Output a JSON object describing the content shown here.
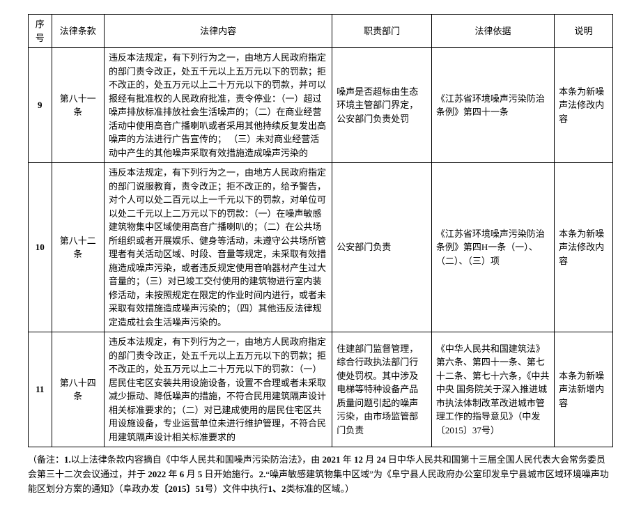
{
  "headers": {
    "idx": "序号",
    "article": "法律条款",
    "content": "法律内容",
    "dept": "职责部门",
    "basis": "法律依据",
    "note": "说明"
  },
  "rows": [
    {
      "idx": "9",
      "article": "第八十一条",
      "content": "违反本法规定，有下列行为之一，由地方人民政府指定的部门责令改正，处五千元以上五万元以下的罚款；拒不改正的，处五万元以上二十万元以下的罚款，并可以报经有批准权的人民政府批准，责令停业：（一）超过噪声排放标准排放社会生活噪声的；（二）在商业经营活动中使用高音广播喇叭或者采用其他持续反复发出高噪声的方法进行广告宣传的；\n（三）未对商业经营活动中产生的其他噪声采取有效措施造成噪声污染的",
      "dept": "噪声是否超标由生态环境主管部门界定，公安部门负责处罚",
      "basis": "《江苏省环境噪声污染防治条例》第四十一条",
      "note": "本条为新噪声法修改内容"
    },
    {
      "idx": "10",
      "article": "第八十二条",
      "content": "违反本法规定，有下列行为之一，由地方人民政府指定的部门说服教育，责令改正；拒不改正的，给予警告，对个人可以处二百元以上一千元以下的罚款，对单位可以处二千元以上二万元以下的罚款：（一）在噪声敏感建筑物集中区域使用高音广播喇叭的；（二）在公共场所组织或者开展娱乐、健身等活动，未遵守公共场所管理者有关活动区域、时段、音量等规定，未采取有效措施造成噪声污染，或者违反规定使用音响器材产生过大音量的；（三）对已竣工交付使用的建筑物进行室内装修活动，未按照规定在限定的作业时间内进行，或者未采取有效措施造成噪声污染的；（四）其他违反法律规定造成社会生活噪声污染的。",
      "dept": "公安部门负责",
      "basis": "《江苏省环境噪声污染防治条例》第四H一条（一）、（二）、（三）项",
      "note": "本条为新噪声法修改内容"
    },
    {
      "idx": "11",
      "article": "第八十四条",
      "content": "违反本法规定，有下列行为之一，由地方人民政府指定的部门责令改正，处五千元以上五万元以下的罚款；拒不改正的，处五万元以上二十万元以下的罚款：（一）居民住宅区安装共用设施设备，设置不合理或者未采取减少振动、降低噪声的措施，不符合民用建筑隔声设计相关标准要求的；（二）对已建成使用的居民住宅区共用设施设备，专业运营单位未进行维护管理，不符合民用建筑隔声设计相关标准要求的",
      "dept": "住建部门监督管理，综合行政执法部门行使处罚权。其中涉及电梯等特种设备产品质量问题引起的噪声污染，由市场监管部门负责",
      "basis": "《中华人民共和国建筑法》第六条、第四十一条、第七十二条、第七十六条，《中共中央 国务院关于深入推进城市执法体制改革改进城市管理工作的指导意见》（中发〔2015〕37号）",
      "note": "本条为新噪声法新增内容"
    }
  ],
  "footnote": {
    "prefix": "（备注：",
    "one_label": "1.",
    "one_body_a": "以上法律条款内容摘自《中华人民共和国噪声污染防治法》，由",
    "one_year1": " 2021 ",
    "one_body_b": "年",
    "one_month1": " 12 ",
    "one_body_c": "月",
    "one_day1": " 24 ",
    "one_body_d": "日中华人民共和国第十三届全国人民代表大会常务委员会第三十二次会议通过，并于",
    "one_year2": " 2022 ",
    "one_body_e": "年",
    "one_month2": " 6 ",
    "one_body_f": "月",
    "one_day2": " 5 ",
    "one_body_g": "日开始施行。",
    "two_label": "2.",
    "two_body_a": "“噪声敏感建筑物集中区域”为《阜宁县人民政府办公室印发阜宁县城市区域环境噪声功能区划分方案的通知》（阜政办发",
    "two_year": "〔2015〕51",
    "two_body_b": "号）文件中执行",
    "two_class": "1、2",
    "two_body_c": "类标准的区域。）"
  }
}
